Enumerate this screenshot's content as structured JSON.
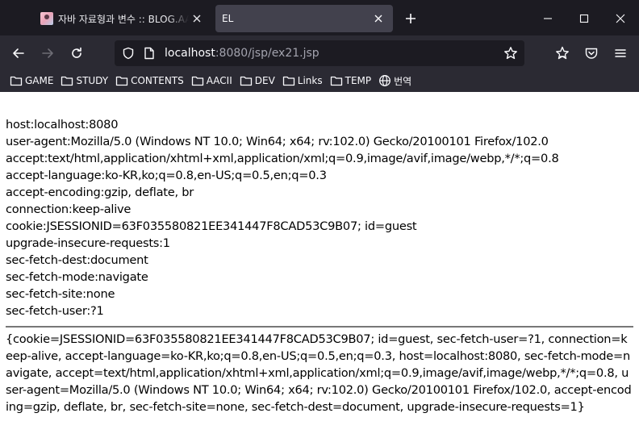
{
  "browser": {
    "tabs": [
      {
        "title": "자바 자료형과 변수 :: BLOG.AACII",
        "active": false
      },
      {
        "title": "EL",
        "active": true
      }
    ],
    "url": {
      "host": "localhost",
      "rest": ":8080/jsp/ex21.jsp"
    },
    "bookmarks": [
      {
        "label": "GAME",
        "icon": "folder-icon"
      },
      {
        "label": "STUDY",
        "icon": "folder-icon"
      },
      {
        "label": "CONTENTS",
        "icon": "folder-icon"
      },
      {
        "label": "AACII",
        "icon": "folder-icon"
      },
      {
        "label": "DEV",
        "icon": "folder-icon"
      },
      {
        "label": "Links",
        "icon": "folder-icon"
      },
      {
        "label": "TEMP",
        "icon": "folder-icon"
      },
      {
        "label": "번역",
        "icon": "globe-icon"
      }
    ],
    "colors": {
      "tabstrip": "#1c1b22",
      "toolbar": "#2b2a33",
      "active_tab": "#42414d"
    }
  },
  "page": {
    "headers": [
      "host:localhost:8080",
      "user-agent:Mozilla/5.0 (Windows NT 10.0; Win64; x64; rv:102.0) Gecko/20100101 Firefox/102.0",
      "accept:text/html,application/xhtml+xml,application/xml;q=0.9,image/avif,image/webp,*/*;q=0.8",
      "accept-language:ko-KR,ko;q=0.8,en-US;q=0.5,en;q=0.3",
      "accept-encoding:gzip, deflate, br",
      "connection:keep-alive",
      "cookie:JSESSIONID=63F035580821EE341447F8CAD53C9B07; id=guest",
      "upgrade-insecure-requests:1",
      "sec-fetch-dest:document",
      "sec-fetch-mode:navigate",
      "sec-fetch-site:none",
      "sec-fetch-user:?1"
    ],
    "header_map": "{cookie=JSESSIONID=63F035580821EE341447F8CAD53C9B07; id=guest, sec-fetch-user=?1, connection=keep-alive, accept-language=ko-KR,ko;q=0.8,en-US;q=0.5,en;q=0.3, host=localhost:8080, sec-fetch-mode=navigate, accept=text/html,application/xhtml+xml,application/xml;q=0.9,image/avif,image/webp,*/*;q=0.8, user-agent=Mozilla/5.0 (Windows NT 10.0; Win64; x64; rv:102.0) Gecko/20100101 Firefox/102.0, accept-encoding=gzip, deflate, br, sec-fetch-site=none, sec-fetch-dest=document, upgrade-insecure-requests=1}"
  }
}
